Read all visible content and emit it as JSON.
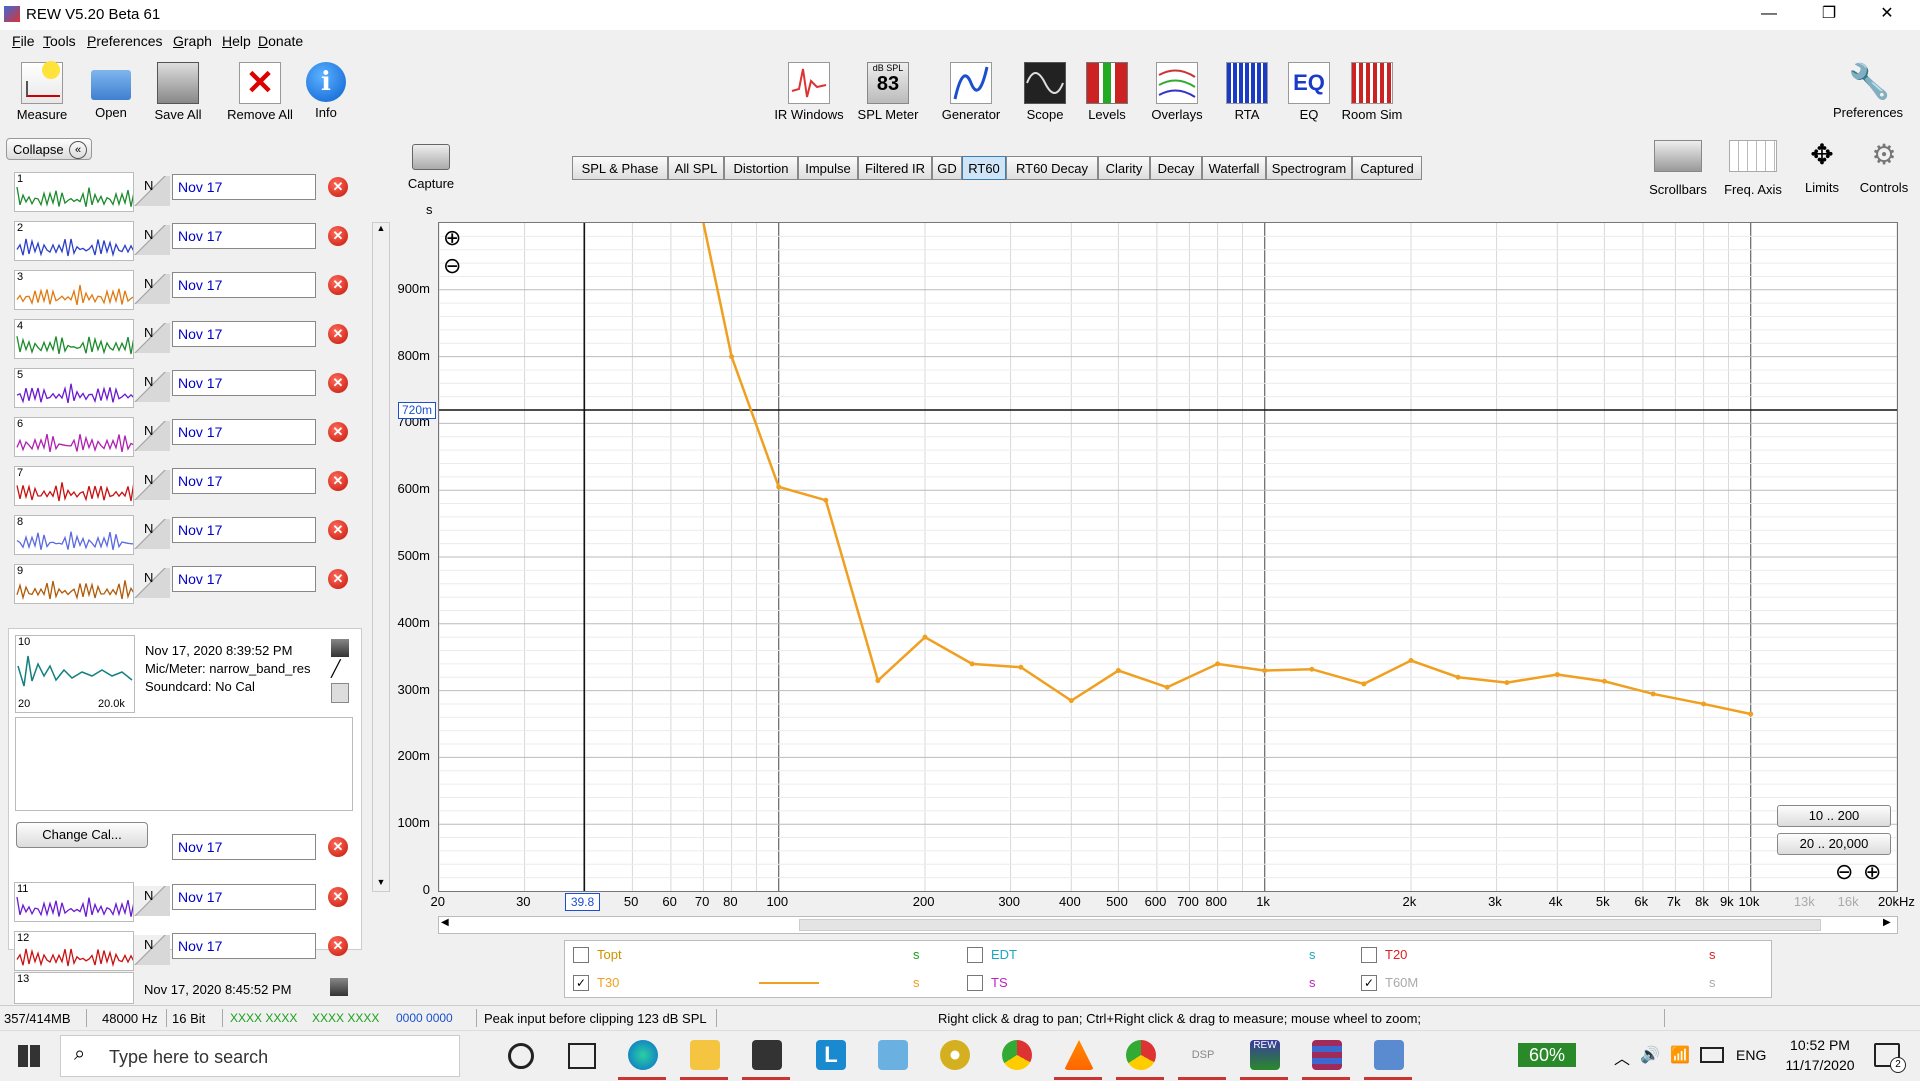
{
  "window": {
    "title": "REW V5.20 Beta 61",
    "minimize": "—",
    "restore": "❐",
    "close": "✕"
  },
  "menu": [
    "File",
    "Tools",
    "Preferences",
    "Graph",
    "Help",
    "Donate"
  ],
  "toolbar_left": [
    {
      "label": "Measure",
      "icon": "measure-icon"
    },
    {
      "label": "Open",
      "icon": "folder-icon"
    },
    {
      "label": "Save All",
      "icon": "save-icon"
    },
    {
      "label": "Remove All",
      "icon": "remove-all-icon"
    },
    {
      "label": "Info",
      "icon": "info-icon"
    }
  ],
  "toolbar_center": [
    {
      "label": "IR Windows",
      "icon": "ir-windows-icon"
    },
    {
      "label": "SPL Meter",
      "icon": "spl-meter-icon",
      "badge_top": "dB SPL",
      "badge_value": "83"
    },
    {
      "label": "Generator",
      "icon": "generator-icon"
    },
    {
      "label": "Scope",
      "icon": "scope-icon"
    },
    {
      "label": "Levels",
      "icon": "levels-icon"
    },
    {
      "label": "Overlays",
      "icon": "overlays-icon"
    },
    {
      "label": "RTA",
      "icon": "rta-icon"
    },
    {
      "label": "EQ",
      "icon": "eq-icon"
    },
    {
      "label": "Room Sim",
      "icon": "room-sim-icon"
    }
  ],
  "toolbar_right": {
    "label": "Preferences",
    "icon": "wrench-icon"
  },
  "left_panel": {
    "collapse_label": "Collapse",
    "measurements": [
      {
        "num": "1",
        "name": "Nov 17",
        "color": "#1a8a2a"
      },
      {
        "num": "2",
        "name": "Nov 17",
        "color": "#2c3ec8"
      },
      {
        "num": "3",
        "name": "Nov 17",
        "color": "#e07a10"
      },
      {
        "num": "4",
        "name": "Nov 17",
        "color": "#1a8a2a"
      },
      {
        "num": "5",
        "name": "Nov 17",
        "color": "#6a1ad0"
      },
      {
        "num": "6",
        "name": "Nov 17",
        "color": "#b020b0"
      },
      {
        "num": "7",
        "name": "Nov 17",
        "color": "#c81010"
      },
      {
        "num": "8",
        "name": "Nov 17",
        "color": "#5a6ae0"
      },
      {
        "num": "9",
        "name": "Nov 17",
        "color": "#b05a08"
      }
    ],
    "selected": {
      "num": "10",
      "date": "Nov 17, 2020 8:39:52 PM",
      "mic": "Mic/Meter: narrow_band_res",
      "soundcard": "Soundcard: No Cal",
      "thumb_min": "20",
      "thumb_max": "20.0k",
      "name": "Nov 17",
      "change_cal": "Change Cal..."
    },
    "measurements_after": [
      {
        "num": "11",
        "name": "Nov 17",
        "color": "#6a1ad0"
      },
      {
        "num": "12",
        "name": "Nov 17",
        "color": "#c81010"
      }
    ],
    "last": {
      "num": "13",
      "date": "Nov 17, 2020 8:45:52 PM"
    },
    "trunc_label": "N"
  },
  "graph": {
    "capture_label": "Capture",
    "unit": "s",
    "tabs": [
      "SPL & Phase",
      "All SPL",
      "Distortion",
      "Impulse",
      "Filtered IR",
      "GD",
      "RT60",
      "RT60 Decay",
      "Clarity",
      "Decay",
      "Waterfall",
      "Spectrogram",
      "Captured"
    ],
    "active_tab": "RT60",
    "right_tools": [
      {
        "label": "Scrollbars",
        "icon": "scrollbars-icon"
      },
      {
        "label": "Freq. Axis",
        "icon": "freq-axis-icon"
      },
      {
        "label": "Limits",
        "icon": "limits-icon"
      },
      {
        "label": "Controls",
        "icon": "controls-gear-icon"
      }
    ],
    "cursor_y_label": "720m",
    "cursor_x_label": "39.8",
    "range_buttons": [
      "10 .. 200",
      "20 .. 20,000"
    ],
    "plus": "⊕",
    "minus": "⊖"
  },
  "chart_data": {
    "type": "line",
    "xscale": "log",
    "xlim": [
      20,
      20000
    ],
    "ylim": [
      0,
      1.0
    ],
    "ylabel": "s",
    "yticks": [
      {
        "v": 0,
        "t": "0"
      },
      {
        "v": 0.1,
        "t": "100m"
      },
      {
        "v": 0.2,
        "t": "200m"
      },
      {
        "v": 0.3,
        "t": "300m"
      },
      {
        "v": 0.4,
        "t": "400m"
      },
      {
        "v": 0.5,
        "t": "500m"
      },
      {
        "v": 0.6,
        "t": "600m"
      },
      {
        "v": 0.7,
        "t": "700m"
      },
      {
        "v": 0.8,
        "t": "800m"
      },
      {
        "v": 0.9,
        "t": "900m"
      }
    ],
    "xticks": [
      {
        "v": 20,
        "t": "20"
      },
      {
        "v": 30,
        "t": "30"
      },
      {
        "v": 50,
        "t": "50"
      },
      {
        "v": 60,
        "t": "60"
      },
      {
        "v": 70,
        "t": "70"
      },
      {
        "v": 80,
        "t": "80"
      },
      {
        "v": 100,
        "t": "100"
      },
      {
        "v": 200,
        "t": "200"
      },
      {
        "v": 300,
        "t": "300"
      },
      {
        "v": 400,
        "t": "400"
      },
      {
        "v": 500,
        "t": "500"
      },
      {
        "v": 600,
        "t": "600"
      },
      {
        "v": 700,
        "t": "700"
      },
      {
        "v": 800,
        "t": "800"
      },
      {
        "v": 1000,
        "t": "1k"
      },
      {
        "v": 2000,
        "t": "2k"
      },
      {
        "v": 3000,
        "t": "3k"
      },
      {
        "v": 4000,
        "t": "4k"
      },
      {
        "v": 5000,
        "t": "5k"
      },
      {
        "v": 6000,
        "t": "6k"
      },
      {
        "v": 7000,
        "t": "7k"
      },
      {
        "v": 8000,
        "t": "8k"
      },
      {
        "v": 9000,
        "t": "9k"
      },
      {
        "v": 10000,
        "t": "10k"
      },
      {
        "v": 13000,
        "t": "13k",
        "grey": true
      },
      {
        "v": 16000,
        "t": "16k",
        "grey": true
      },
      {
        "v": 20000,
        "t": "20kHz"
      }
    ],
    "series": [
      {
        "name": "T30",
        "color": "#f0a020",
        "x": [
          70,
          80,
          100,
          125,
          160,
          200,
          250,
          315,
          400,
          500,
          630,
          800,
          1000,
          1250,
          1600,
          2000,
          2500,
          3150,
          4000,
          5000,
          6300,
          8000,
          10000
        ],
        "y": [
          1.0,
          0.8,
          0.605,
          0.585,
          0.315,
          0.38,
          0.34,
          0.335,
          0.285,
          0.33,
          0.305,
          0.34,
          0.33,
          0.332,
          0.31,
          0.345,
          0.32,
          0.312,
          0.324,
          0.314,
          0.295,
          0.28,
          0.265
        ]
      }
    ],
    "cursor": {
      "x": 39.8,
      "y": 0.72
    }
  },
  "legend": [
    {
      "label": "Topt",
      "checked": false,
      "unit": "s",
      "color": "#d09000",
      "unit_color": "#1aa01a"
    },
    {
      "label": "EDT",
      "checked": false,
      "unit": "s",
      "color": "#1aa8c0",
      "unit_color": "#1aa8c0"
    },
    {
      "label": "T20",
      "checked": false,
      "unit": "s",
      "color": "#e02020",
      "unit_color": "#e02020"
    },
    {
      "label": "T30",
      "checked": true,
      "unit": "s",
      "color": "#f0a020",
      "unit_color": "#f0a020"
    },
    {
      "label": "TS",
      "checked": false,
      "unit": "s",
      "color": "#c020c0",
      "unit_color": "#c020c0"
    },
    {
      "label": "T60M",
      "checked": true,
      "unit": "s",
      "color": "#aaaaaa",
      "unit_color": "#aaaaaa"
    }
  ],
  "status": {
    "memory": "357/414MB",
    "rate": "48000 Hz",
    "bits": "16 Bit",
    "io1": "XXXX XXXX",
    "io2": "XXXX XXXX",
    "io3": "0000 0000",
    "peak": "Peak input before clipping 123 dB SPL",
    "hint": "Right click & drag to pan; Ctrl+Right click & drag to measure; mouse wheel to zoom;"
  },
  "taskbar": {
    "search_placeholder": "Type here to search",
    "battery": "60%",
    "lang": "ENG",
    "time": "10:52 PM",
    "date": "11/17/2020",
    "notif": "2"
  }
}
